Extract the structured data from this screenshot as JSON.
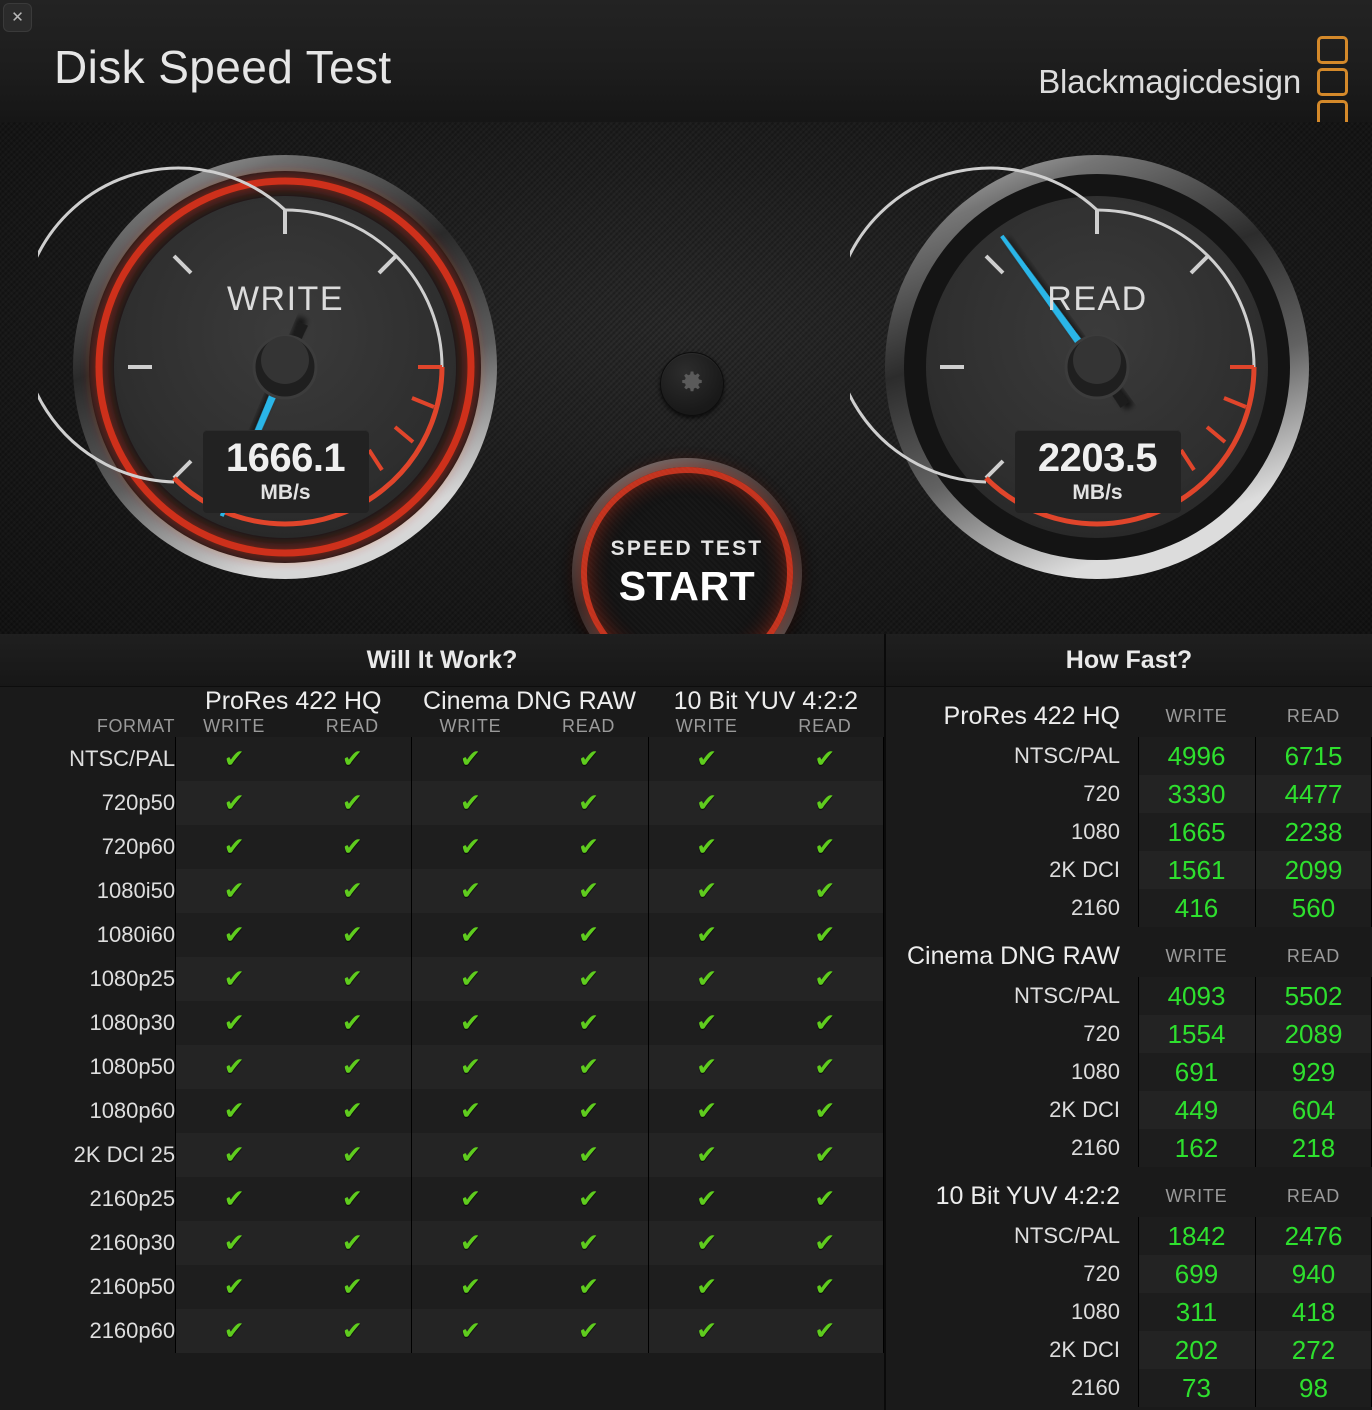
{
  "window": {
    "close_label": "✕",
    "title": "Disk Speed Test"
  },
  "brand": {
    "text": "Blackmagicdesign",
    "logo_icon": "blackmagic-logo-icon",
    "logo_color": "#d4892a"
  },
  "gauges": {
    "write": {
      "label": "WRITE",
      "value": "1666.1",
      "unit": "MB/s",
      "needle_color": "#29b6e8",
      "needle_angle_deg": -157,
      "active_glow": true
    },
    "read": {
      "label": "READ",
      "value": "2203.5",
      "unit": "MB/s",
      "needle_color": "#29b6e8",
      "needle_angle_deg": -36,
      "active_glow": false
    }
  },
  "controls": {
    "gear_icon": "gear-icon",
    "start": {
      "kicker": "SPEED TEST",
      "main": "START",
      "ring_color": "#cd341e"
    }
  },
  "will_it_work": {
    "title": "Will It Work?",
    "format_header": "FORMAT",
    "groups": [
      "ProRes 422 HQ",
      "Cinema DNG RAW",
      "10 Bit YUV 4:2:2"
    ],
    "sub_headers": [
      "WRITE",
      "READ"
    ],
    "check_icon": "✔",
    "check_color": "#5fcc1e",
    "rows": [
      {
        "format": "NTSC/PAL",
        "cells": [
          true,
          true,
          true,
          true,
          true,
          true
        ]
      },
      {
        "format": "720p50",
        "cells": [
          true,
          true,
          true,
          true,
          true,
          true
        ]
      },
      {
        "format": "720p60",
        "cells": [
          true,
          true,
          true,
          true,
          true,
          true
        ]
      },
      {
        "format": "1080i50",
        "cells": [
          true,
          true,
          true,
          true,
          true,
          true
        ]
      },
      {
        "format": "1080i60",
        "cells": [
          true,
          true,
          true,
          true,
          true,
          true
        ]
      },
      {
        "format": "1080p25",
        "cells": [
          true,
          true,
          true,
          true,
          true,
          true
        ]
      },
      {
        "format": "1080p30",
        "cells": [
          true,
          true,
          true,
          true,
          true,
          true
        ]
      },
      {
        "format": "1080p50",
        "cells": [
          true,
          true,
          true,
          true,
          true,
          true
        ]
      },
      {
        "format": "1080p60",
        "cells": [
          true,
          true,
          true,
          true,
          true,
          true
        ]
      },
      {
        "format": "2K DCI 25",
        "cells": [
          true,
          true,
          true,
          true,
          true,
          true
        ]
      },
      {
        "format": "2160p25",
        "cells": [
          true,
          true,
          true,
          true,
          true,
          true
        ]
      },
      {
        "format": "2160p30",
        "cells": [
          true,
          true,
          true,
          true,
          true,
          true
        ]
      },
      {
        "format": "2160p50",
        "cells": [
          true,
          true,
          true,
          true,
          true,
          true
        ]
      },
      {
        "format": "2160p60",
        "cells": [
          true,
          true,
          true,
          true,
          true,
          true
        ]
      }
    ]
  },
  "how_fast": {
    "title": "How Fast?",
    "sub_headers": [
      "WRITE",
      "READ"
    ],
    "value_color": "#2ee02e",
    "sections": [
      {
        "name": "ProRes 422 HQ",
        "rows": [
          {
            "res": "NTSC/PAL",
            "write": "4996",
            "read": "6715"
          },
          {
            "res": "720",
            "write": "3330",
            "read": "4477"
          },
          {
            "res": "1080",
            "write": "1665",
            "read": "2238"
          },
          {
            "res": "2K DCI",
            "write": "1561",
            "read": "2099"
          },
          {
            "res": "2160",
            "write": "416",
            "read": "560"
          }
        ]
      },
      {
        "name": "Cinema DNG RAW",
        "rows": [
          {
            "res": "NTSC/PAL",
            "write": "4093",
            "read": "5502"
          },
          {
            "res": "720",
            "write": "1554",
            "read": "2089"
          },
          {
            "res": "1080",
            "write": "691",
            "read": "929"
          },
          {
            "res": "2K DCI",
            "write": "449",
            "read": "604"
          },
          {
            "res": "2160",
            "write": "162",
            "read": "218"
          }
        ]
      },
      {
        "name": "10 Bit YUV 4:2:2",
        "rows": [
          {
            "res": "NTSC/PAL",
            "write": "1842",
            "read": "2476"
          },
          {
            "res": "720",
            "write": "699",
            "read": "940"
          },
          {
            "res": "1080",
            "write": "311",
            "read": "418"
          },
          {
            "res": "2K DCI",
            "write": "202",
            "read": "272"
          },
          {
            "res": "2160",
            "write": "73",
            "read": "98"
          }
        ]
      }
    ]
  }
}
